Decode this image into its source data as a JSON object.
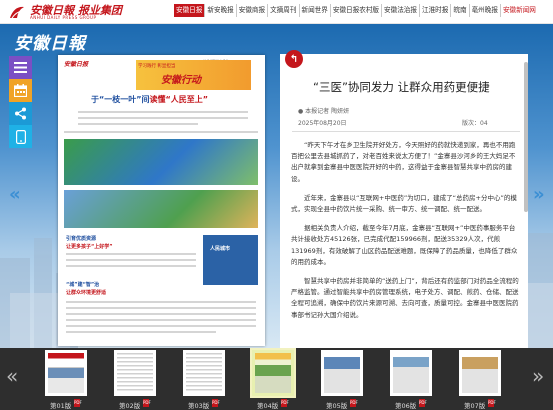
{
  "header": {
    "logo_main": "安徽日報 报业集团",
    "logo_sub": "ANHUI DAILY PRESS GROUP",
    "nav": [
      {
        "label": "安徽日报",
        "active": true
      },
      {
        "label": "新安晚报"
      },
      {
        "label": "安徽商报"
      },
      {
        "label": "文摘周刊"
      },
      {
        "label": "新闻世界"
      },
      {
        "label": "安徽日报农村版"
      },
      {
        "label": "安徽法治报"
      },
      {
        "label": "江淮时报"
      },
      {
        "label": "皖南"
      },
      {
        "label": "亳州晚报"
      },
      {
        "label": "安徽新闻网",
        "highlight": true
      }
    ]
  },
  "banner": {
    "brand": "安徽日報"
  },
  "toolbar": {
    "items": [
      {
        "name": "menu-icon",
        "color": "#7b4fc4"
      },
      {
        "name": "calendar-icon",
        "color": "#f0a326"
      },
      {
        "name": "share-icon",
        "color": "#1c9ad6"
      },
      {
        "name": "mobile-icon",
        "color": "#1fb1e6"
      }
    ]
  },
  "paper": {
    "masthead": "安徽日报",
    "page_info": "特别报道 | 04",
    "banner_small": "学习践行 彰显担当",
    "banner_big": "安徽行动",
    "headline_black": "于“一枝一叶”间",
    "headline_red": "读懂“人民至上”",
    "col1": "引育优质资源",
    "col1b": "让更多孩子“上好学”",
    "col2": "“城”建“智”治",
    "col2b": "让群众环境更舒适",
    "side": "人民城市"
  },
  "article": {
    "back_symbol": "↰",
    "title": "“三医”协同发力 让群众用药更便捷",
    "author": "本报记者 陶妍妍",
    "date": "2025年08月20日",
    "edition": "版次：04",
    "paragraphs": [
      "“昨天下午才在乡卫生院开好处方，今天照好的药就快递到家，再也不用跑百把公里去县城抓药了，对老百姓来说太方便了！”金寨县沙河乡的王大妈足不出户就拿到金寨县中医医院开好的中药，这得益于金寨县智慧共享中药房的建设。",
      "近年来，金寨县以“互联网+中医药”为切口，建成了“总药房+分中心”的模式，实现全县中药饮片统一采购、统一审方、统一调配、统一配送。",
      "据相关负责人介绍，截至今年7月底，金寨县“互联网+”中医药事服务平台共计接收处方45126张，已完成代配159966剂，配送35329人次，代煎131969剂，有效破解了山区药品配送难题，既保障了药品质量，也降低了群众的用药成本。",
      "智慧共享中药房并非简单的“送药上门”，背后还有药监部门对药品全流程的严格监管。通过智能共享中药房管理系统，电子处方、调配、煎药、仓储、配送全程可追溯，确保中药饮片来源可溯、去向可查，质量可控。金寨县中医医院药事部书记孙大国介绍说。"
    ]
  },
  "thumbnails": [
    {
      "label": "第01版",
      "pdf": "PDF"
    },
    {
      "label": "第02版",
      "pdf": "PDF"
    },
    {
      "label": "第03版",
      "pdf": "PDF"
    },
    {
      "label": "第04版",
      "pdf": "PDF",
      "selected": true
    },
    {
      "label": "第05版",
      "pdf": "PDF"
    },
    {
      "label": "第06版",
      "pdf": "PDF"
    },
    {
      "label": "第07版",
      "pdf": "PDF"
    }
  ],
  "arrows": {
    "left": "«",
    "right": "»"
  }
}
